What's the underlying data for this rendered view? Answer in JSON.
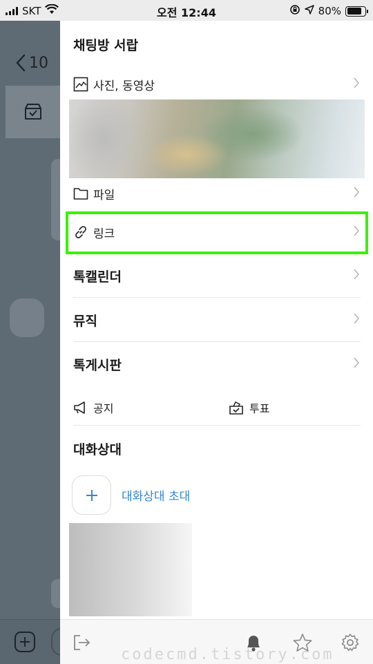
{
  "status_bar": {
    "carrier": "SKT",
    "time": "오전 12:44",
    "battery": "80%",
    "battery_level": 0.8
  },
  "background_chat": {
    "back_count": "10"
  },
  "drawer": {
    "title": "채팅방 서랍",
    "items": {
      "media": "사진, 동영상",
      "file": "파일",
      "link": "링크",
      "calendar": "톡캘린더",
      "music": "뮤직",
      "board": "톡게시판"
    },
    "notice": "공지",
    "vote": "투표",
    "members_title": "대화상대",
    "invite_label": "대화상대 초대"
  },
  "colors": {
    "highlight": "#3cf000",
    "link_blue": "#2f86d8",
    "overlay": "#5f6b74"
  },
  "watermark": "codecmd.tistory.com"
}
